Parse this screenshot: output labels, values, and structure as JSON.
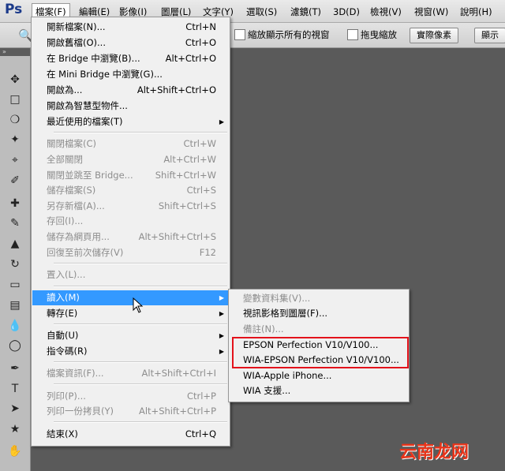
{
  "app": {
    "logo": "Ps"
  },
  "menubar": {
    "items": [
      "檔案(F)",
      "編輯(E)",
      "影像(I)",
      "圖層(L)",
      "文字(Y)",
      "選取(S)",
      "濾鏡(T)",
      "3D(D)",
      "檢視(V)",
      "視窗(W)",
      "說明(H)"
    ]
  },
  "options": {
    "resize_label": "縮放顯示所有的視窗",
    "scrubby_label": "拖曳縮放",
    "actual_pixels": "實際像素",
    "fit_screen": "顯示"
  },
  "toolbox": {
    "header": "»"
  },
  "file_menu": {
    "items": [
      {
        "label": "開新檔案(N)...",
        "shortcut": "Ctrl+N"
      },
      {
        "label": "開啟舊檔(O)...",
        "shortcut": "Ctrl+O"
      },
      {
        "label": "在 Bridge 中瀏覽(B)...",
        "shortcut": "Alt+Ctrl+O"
      },
      {
        "label": "在 Mini Bridge 中瀏覽(G)...",
        "shortcut": ""
      },
      {
        "label": "開啟為...",
        "shortcut": "Alt+Shift+Ctrl+O"
      },
      {
        "label": "開啟為智慧型物件...",
        "shortcut": ""
      },
      {
        "label": "最近使用的檔案(T)",
        "shortcut": ""
      },
      {
        "label": "關閉檔案(C)",
        "shortcut": "Ctrl+W"
      },
      {
        "label": "全部關閉",
        "shortcut": "Alt+Ctrl+W"
      },
      {
        "label": "關閉並跳至 Bridge...",
        "shortcut": "Shift+Ctrl+W"
      },
      {
        "label": "儲存檔案(S)",
        "shortcut": "Ctrl+S"
      },
      {
        "label": "另存新檔(A)...",
        "shortcut": "Shift+Ctrl+S"
      },
      {
        "label": "存回(I)...",
        "shortcut": ""
      },
      {
        "label": "儲存為網頁用...",
        "shortcut": "Alt+Shift+Ctrl+S"
      },
      {
        "label": "回復至前次儲存(V)",
        "shortcut": "F12"
      },
      {
        "label": "置入(L)...",
        "shortcut": ""
      },
      {
        "label": "讀入(M)",
        "shortcut": ""
      },
      {
        "label": "轉存(E)",
        "shortcut": ""
      },
      {
        "label": "自動(U)",
        "shortcut": ""
      },
      {
        "label": "指令碼(R)",
        "shortcut": ""
      },
      {
        "label": "檔案資訊(F)...",
        "shortcut": "Alt+Shift+Ctrl+I"
      },
      {
        "label": "列印(P)...",
        "shortcut": "Ctrl+P"
      },
      {
        "label": "列印一份拷貝(Y)",
        "shortcut": "Alt+Shift+Ctrl+P"
      },
      {
        "label": "結束(X)",
        "shortcut": "Ctrl+Q"
      }
    ]
  },
  "import_submenu": {
    "items": [
      "變數資料集(V)...",
      "視訊影格到圖層(F)...",
      "備註(N)...",
      "EPSON Perfection V10/V100...",
      "WIA-EPSON Perfection V10/V100...",
      "WIA-Apple iPhone...",
      "WIA 支援..."
    ]
  },
  "watermark": "云南龙网"
}
